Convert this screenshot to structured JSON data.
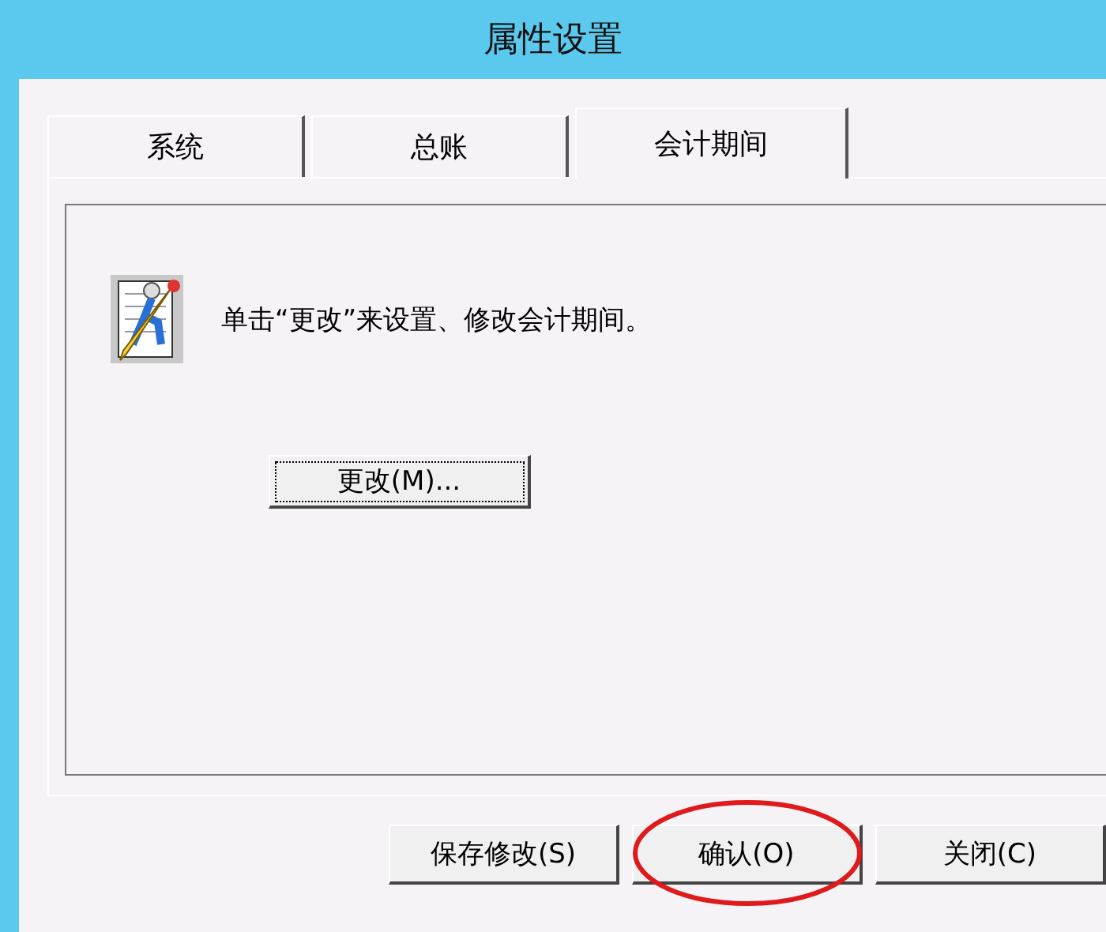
{
  "window": {
    "title": "属性设置"
  },
  "tabs": [
    {
      "label": "系统",
      "selected": false
    },
    {
      "label": "总账",
      "selected": false
    },
    {
      "label": "会计期间",
      "selected": true
    }
  ],
  "panel": {
    "message": "单击“更改”来设置、修改会计期间。",
    "change_button": "更改(M)..."
  },
  "buttons": [
    {
      "label": "保存修改(S)",
      "circled": false
    },
    {
      "label": "确认(O)",
      "circled": true
    },
    {
      "label": "关闭(C)",
      "circled": false
    }
  ]
}
